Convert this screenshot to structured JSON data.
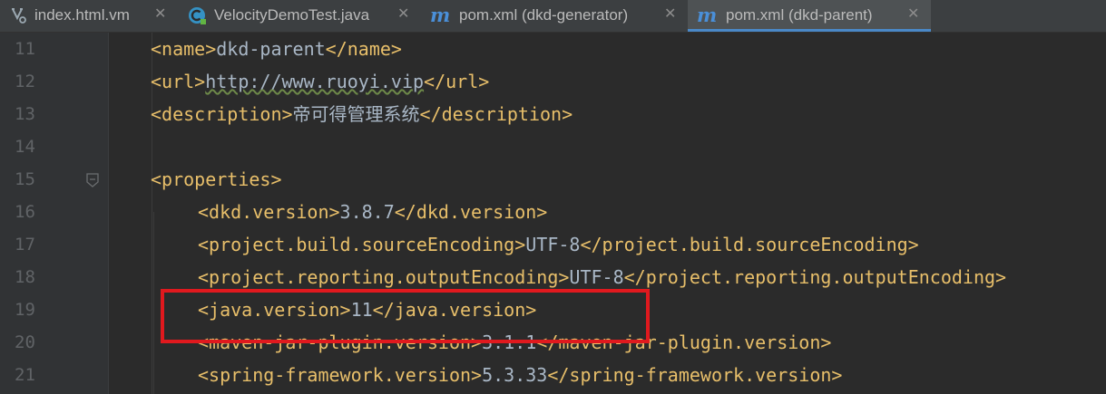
{
  "tabs": [
    {
      "label": "index.html.vm",
      "icon": "velocity-template-icon",
      "active": false
    },
    {
      "label": "VelocityDemoTest.java",
      "icon": "java-class-icon",
      "active": false
    },
    {
      "label": "pom.xml (dkd-generator)",
      "icon": "maven-icon",
      "active": false
    },
    {
      "label": "pom.xml (dkd-parent)",
      "icon": "maven-icon",
      "active": true
    }
  ],
  "close_glyph": "✕",
  "maven_glyph": "m",
  "lines": [
    {
      "no": "11",
      "open": "<name>",
      "text": "dkd-parent",
      "close": "</name>"
    },
    {
      "no": "12",
      "open": "<url>",
      "text": "http://www.ruoyi.vip",
      "close": "</url>"
    },
    {
      "no": "13",
      "open": "<description>",
      "text": "帝可得管理系统",
      "close": "</description>"
    },
    {
      "no": "14",
      "open": "",
      "text": "",
      "close": ""
    },
    {
      "no": "15",
      "open": "<properties>",
      "text": "",
      "close": ""
    },
    {
      "no": "16",
      "open": "<dkd.version>",
      "text": "3.8.7",
      "close": "</dkd.version>"
    },
    {
      "no": "17",
      "open": "<project.build.sourceEncoding>",
      "text": "UTF-8",
      "close": "</project.build.sourceEncoding>"
    },
    {
      "no": "18",
      "open": "<project.reporting.outputEncoding>",
      "text": "UTF-8",
      "close": "</project.reporting.outputEncoding>"
    },
    {
      "no": "19",
      "open": "<java.version>",
      "text": "11",
      "close": "</java.version>"
    },
    {
      "no": "20",
      "open": "<maven-jar-plugin.version>",
      "text": "3.1.1",
      "close": "</maven-jar-plugin.version>"
    },
    {
      "no": "21",
      "open": "<spring-framework.version>",
      "text": "5.3.33",
      "close": "</spring-framework.version>"
    }
  ],
  "colors": {
    "background": "#2b2b2b",
    "tag": "#e8bf6a",
    "text": "#a9b7c6",
    "line_number": "#606366",
    "active_tab_underline": "#4a88c7",
    "highlight_box": "#e0191e"
  }
}
